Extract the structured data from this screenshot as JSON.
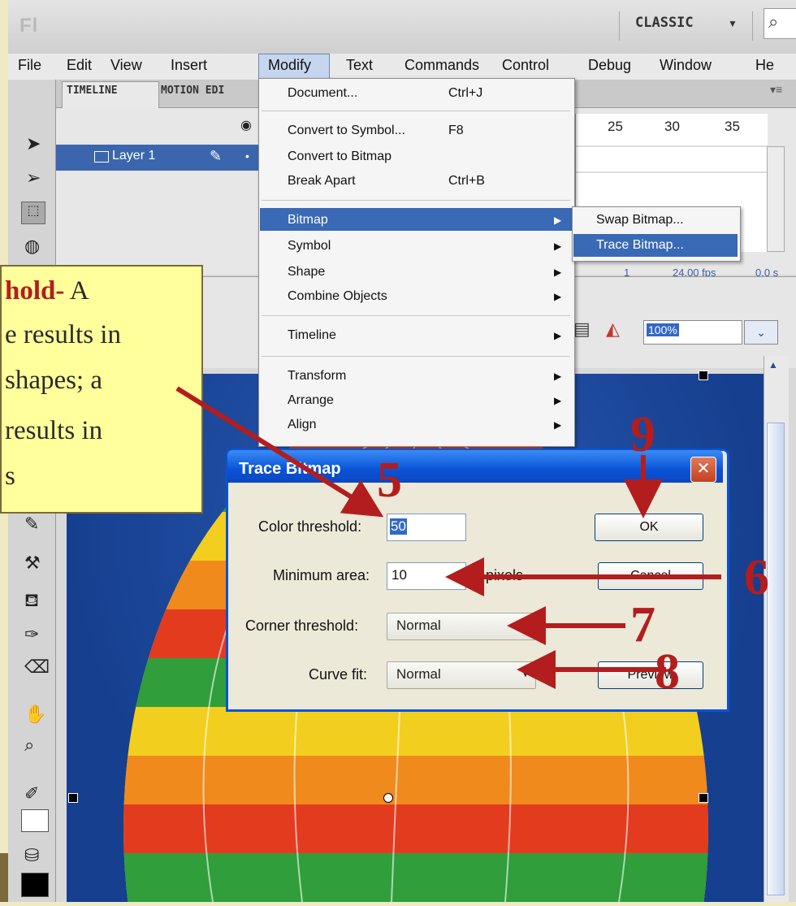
{
  "app": {
    "logo": "Fl",
    "workspace": "CLASSIC",
    "menus": [
      "File",
      "Edit",
      "View",
      "Insert",
      "Modify",
      "Text",
      "Commands",
      "Control",
      "Debug",
      "Window",
      "He"
    ]
  },
  "timeline": {
    "tabs": [
      "TIMELINE",
      "MOTION EDI"
    ],
    "layer_name": "Layer 1",
    "frame_numbers": [
      "25",
      "30",
      "35"
    ],
    "current_frame": "1",
    "fps": "24.00 fps",
    "time": "0.0 s"
  },
  "stage": {
    "zoom": "100%"
  },
  "modify_menu": {
    "items": [
      {
        "label": "Document...",
        "shortcut": "Ctrl+J"
      },
      {
        "label": "Convert to Symbol...",
        "shortcut": "F8"
      },
      {
        "label": "Convert to Bitmap",
        "shortcut": ""
      },
      {
        "label": "Break Apart",
        "shortcut": "Ctrl+B"
      },
      {
        "label": "Bitmap",
        "shortcut": ""
      },
      {
        "label": "Symbol",
        "shortcut": ""
      },
      {
        "label": "Shape",
        "shortcut": ""
      },
      {
        "label": "Combine Objects",
        "shortcut": ""
      },
      {
        "label": "Timeline",
        "shortcut": ""
      },
      {
        "label": "Transform",
        "shortcut": ""
      },
      {
        "label": "Arrange",
        "shortcut": ""
      },
      {
        "label": "Align",
        "shortcut": ""
      }
    ],
    "bitmap_submenu": [
      "Swap Bitmap...",
      "Trace Bitmap..."
    ]
  },
  "dialog": {
    "title": "Trace Bitmap",
    "color_threshold_label": "Color threshold:",
    "color_threshold_value": "50",
    "minimum_area_label": "Minimum area:",
    "minimum_area_value": "10",
    "minimum_area_unit": "pixels",
    "corner_threshold_label": "Corner threshold:",
    "corner_threshold_value": "Normal",
    "curve_fit_label": "Curve fit:",
    "curve_fit_value": "Normal",
    "ok_label": "OK",
    "cancel_label": "Cancel",
    "preview_label": "Preview"
  },
  "callout": {
    "line1_bold": "hold-",
    "line1_rest": " A",
    "line2": "e results in",
    "line3": "shapes; a",
    "line4": "results in",
    "line5": "s"
  },
  "steps": [
    "5",
    "6",
    "7",
    "8",
    "9"
  ],
  "colors": {
    "arrow": "#b31d1d",
    "highlight": "#3a69b5",
    "callout_bg": "#ffff9c",
    "titlebar": "#0a53d6"
  }
}
